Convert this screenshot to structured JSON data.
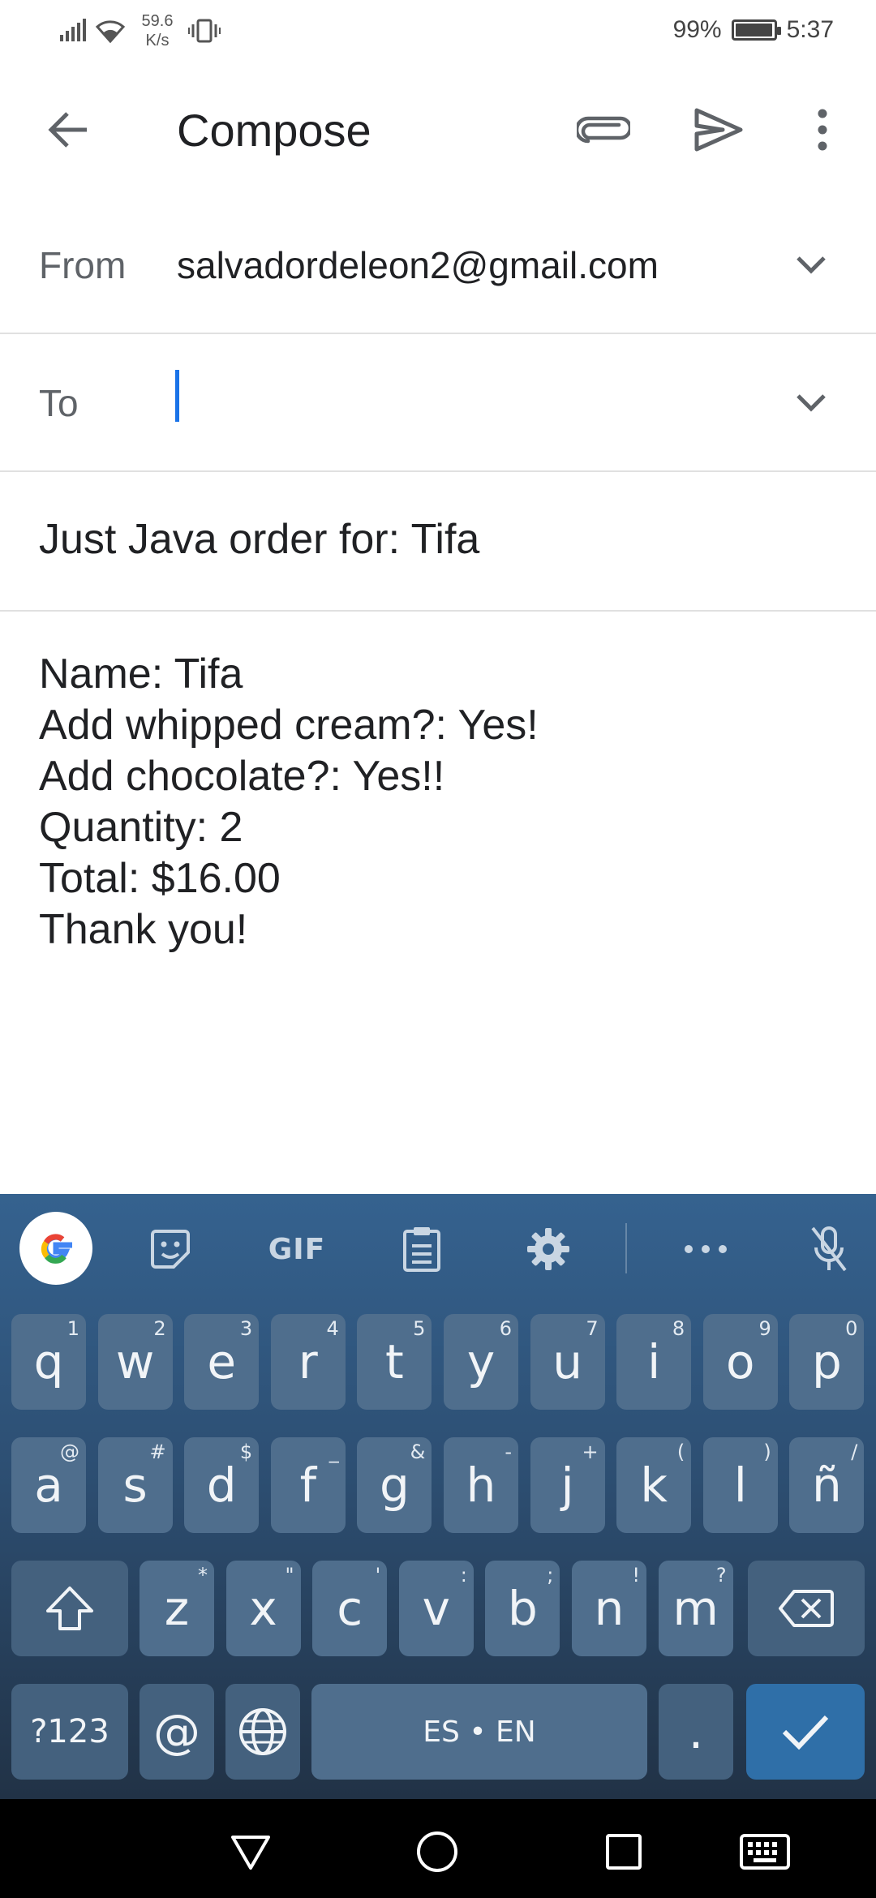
{
  "status_bar": {
    "net_speed": "59.6",
    "net_unit": "K/s",
    "battery_percent": "99%",
    "battery_level": 0.99,
    "time": "5:37"
  },
  "app_bar": {
    "title": "Compose",
    "icons": [
      "arrow-back-icon",
      "paperclip-icon",
      "send-icon",
      "more-vert-icon"
    ]
  },
  "from_field": {
    "label": "From",
    "value": "salvadordeleon2@gmail.com"
  },
  "to_field": {
    "label": "To",
    "value": ""
  },
  "subject": "Just Java order for: Tifa",
  "body": "Name: Tifa\nAdd whipped cream?: Yes!\nAdd chocolate?: Yes!!\nQuantity: 2\nTotal: $16.00\nThank you!",
  "keyboard": {
    "toolbar": {
      "gif_label": "GIF",
      "icons": [
        "google-icon",
        "sticker-icon",
        "clipboard-icon",
        "gear-icon",
        "more-horiz-icon",
        "mic-off-icon"
      ]
    },
    "row1": [
      {
        "key": "q",
        "hint": "1"
      },
      {
        "key": "w",
        "hint": "2"
      },
      {
        "key": "e",
        "hint": "3"
      },
      {
        "key": "r",
        "hint": "4"
      },
      {
        "key": "t",
        "hint": "5"
      },
      {
        "key": "y",
        "hint": "6"
      },
      {
        "key": "u",
        "hint": "7"
      },
      {
        "key": "i",
        "hint": "8"
      },
      {
        "key": "o",
        "hint": "9"
      },
      {
        "key": "p",
        "hint": "0"
      }
    ],
    "row2": [
      {
        "key": "a",
        "hint": "@"
      },
      {
        "key": "s",
        "hint": "#"
      },
      {
        "key": "d",
        "hint": "$"
      },
      {
        "key": "f",
        "hint": "_"
      },
      {
        "key": "g",
        "hint": "&"
      },
      {
        "key": "h",
        "hint": "-"
      },
      {
        "key": "j",
        "hint": "+"
      },
      {
        "key": "k",
        "hint": "("
      },
      {
        "key": "l",
        "hint": ")"
      },
      {
        "key": "ñ",
        "hint": "/"
      }
    ],
    "row3": [
      {
        "key": "z",
        "hint": "*"
      },
      {
        "key": "x",
        "hint": "\""
      },
      {
        "key": "c",
        "hint": "'"
      },
      {
        "key": "v",
        "hint": ":"
      },
      {
        "key": "b",
        "hint": ";"
      },
      {
        "key": "n",
        "hint": "!"
      },
      {
        "key": "m",
        "hint": "?"
      }
    ],
    "symbols_label": "?123",
    "at_label": "@",
    "space_label": "ES • EN",
    "period_label": "."
  },
  "nav_bar": {
    "icons": [
      "nav-back-icon",
      "nav-home-icon",
      "nav-recents-icon",
      "keyboard-toggle-icon"
    ]
  }
}
